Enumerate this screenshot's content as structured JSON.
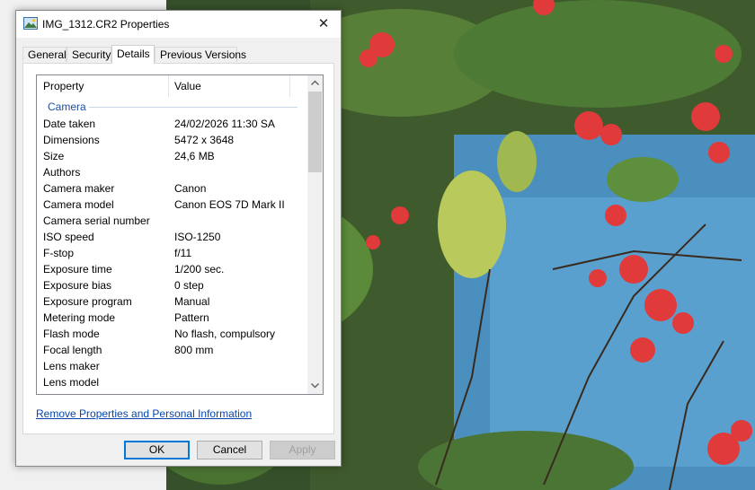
{
  "window": {
    "title": "IMG_1312.CR2 Properties",
    "close_glyph": "✕",
    "icon": "image-file-icon"
  },
  "tabs": [
    {
      "label": "General",
      "active": false
    },
    {
      "label": "Security",
      "active": false
    },
    {
      "label": "Details",
      "active": true
    },
    {
      "label": "Previous Versions",
      "active": false
    }
  ],
  "details": {
    "columns": {
      "property": "Property",
      "value": "Value"
    },
    "group": "Camera",
    "rows": [
      {
        "property": "Date taken",
        "value": "24/02/2026 11:30 SA"
      },
      {
        "property": "Dimensions",
        "value": "5472 x 3648"
      },
      {
        "property": "Size",
        "value": "24,6 MB"
      },
      {
        "property": "Authors",
        "value": ""
      },
      {
        "property": "Camera maker",
        "value": "Canon"
      },
      {
        "property": "Camera model",
        "value": "Canon EOS 7D Mark II"
      },
      {
        "property": "Camera serial number",
        "value": ""
      },
      {
        "property": "ISO speed",
        "value": "ISO-1250"
      },
      {
        "property": "F-stop",
        "value": "f/11"
      },
      {
        "property": "Exposure time",
        "value": "1/200 sec."
      },
      {
        "property": "Exposure bias",
        "value": "0 step"
      },
      {
        "property": "Exposure program",
        "value": "Manual"
      },
      {
        "property": "Metering mode",
        "value": "Pattern"
      },
      {
        "property": "Flash mode",
        "value": "No flash, compulsory"
      },
      {
        "property": "Focal length",
        "value": "800 mm"
      },
      {
        "property": "Lens maker",
        "value": ""
      },
      {
        "property": "Lens model",
        "value": ""
      }
    ]
  },
  "links": {
    "remove": "Remove Properties and Personal Information"
  },
  "buttons": {
    "ok": "OK",
    "cancel": "Cancel",
    "apply": "Apply"
  },
  "colors": {
    "accent": "#0078d7",
    "group_title": "#1e50a2",
    "link": "#0645ad"
  }
}
